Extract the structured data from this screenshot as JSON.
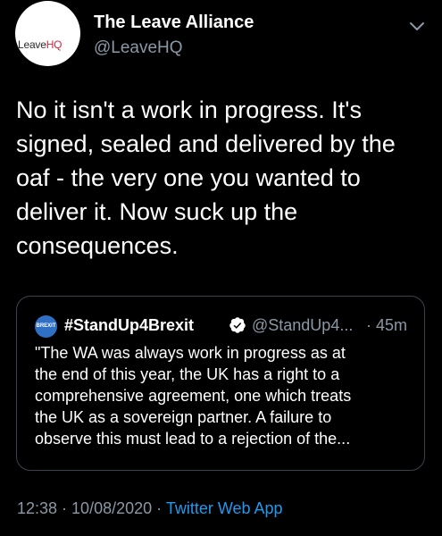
{
  "author": {
    "display_name": "The Leave Alliance",
    "handle": "@LeaveHQ",
    "avatar_logo_part1": "Leave",
    "avatar_logo_part2": "HQ"
  },
  "tweet": {
    "lines": [
      "No it isn't a work in progress. It's",
      "signed, sealed and delivered by the",
      "oaf - the very one you wanted to",
      "deliver it. Now suck up the",
      "consequences."
    ]
  },
  "quoted": {
    "avatar_text": "BREXIT",
    "display_name": "#StandUp4Brexit",
    "handle": "@StandUp4...",
    "time": "· 45m",
    "lines": [
      "\"The WA was always work in progress as at",
      "the end of this year, the UK has a right to a",
      "comprehensive agreement, one which treats",
      "the UK as a sovereign partner. A failure to",
      "observe this must lead to a rejection of the..."
    ]
  },
  "meta": {
    "time": "12:38",
    "separator": " · ",
    "date": "10/08/2020",
    "source": "Twitter Web App"
  },
  "colors": {
    "background": "#000000",
    "text": "#ffffff",
    "secondary": "#8b98a5",
    "link": "#1d9bf0",
    "card_border": "#38444d",
    "verified": "#1d9bf0"
  },
  "icons": [
    "chevron-down-icon",
    "verified-badge-icon"
  ]
}
